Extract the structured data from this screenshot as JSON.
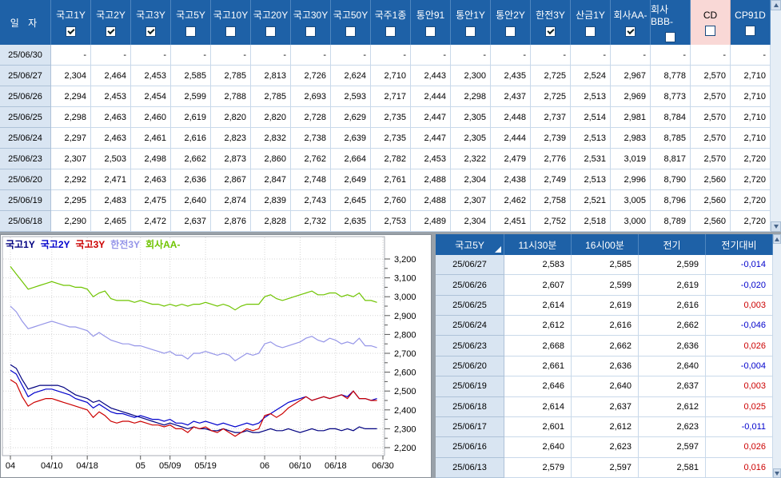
{
  "colors": {
    "header_blue": "#1e61a7",
    "header_separator": "#4f86bf",
    "date_cell_bg": "#d9e5f2",
    "grid_line": "#c9d9ea",
    "cd_header_bg": "#f9d8d6",
    "positive_red": "#cc0000",
    "negative_blue": "#0000cc",
    "window_gap": "#99a1a9"
  },
  "top_table": {
    "date_header": "일 자",
    "columns": [
      {
        "label": "국고1Y",
        "checked": true,
        "highlight": false
      },
      {
        "label": "국고2Y",
        "checked": true,
        "highlight": false
      },
      {
        "label": "국고3Y",
        "checked": true,
        "highlight": false
      },
      {
        "label": "국고5Y",
        "checked": false,
        "highlight": false
      },
      {
        "label": "국고10Y",
        "checked": false,
        "highlight": false
      },
      {
        "label": "국고20Y",
        "checked": false,
        "highlight": false
      },
      {
        "label": "국고30Y",
        "checked": false,
        "highlight": false
      },
      {
        "label": "국고50Y",
        "checked": false,
        "highlight": false
      },
      {
        "label": "국주1종",
        "checked": false,
        "highlight": false
      },
      {
        "label": "통안91",
        "checked": false,
        "highlight": false
      },
      {
        "label": "통안1Y",
        "checked": false,
        "highlight": false
      },
      {
        "label": "통안2Y",
        "checked": false,
        "highlight": false
      },
      {
        "label": "한전3Y",
        "checked": true,
        "highlight": false
      },
      {
        "label": "산금1Y",
        "checked": false,
        "highlight": false
      },
      {
        "label": "회사AA-",
        "checked": true,
        "highlight": false
      },
      {
        "label": "회사BBB-",
        "checked": false,
        "highlight": false
      },
      {
        "label": "CD",
        "checked": false,
        "highlight": true
      },
      {
        "label": "CP91D",
        "checked": false,
        "highlight": false
      }
    ],
    "rows": [
      {
        "date": "25/06/30",
        "values": [
          "-",
          "-",
          "-",
          "-",
          "-",
          "-",
          "-",
          "-",
          "-",
          "-",
          "-",
          "-",
          "-",
          "-",
          "-",
          "-",
          "-",
          "-"
        ]
      },
      {
        "date": "25/06/27",
        "values": [
          "2,304",
          "2,464",
          "2,453",
          "2,585",
          "2,785",
          "2,813",
          "2,726",
          "2,624",
          "2,710",
          "2,443",
          "2,300",
          "2,435",
          "2,725",
          "2,524",
          "2,967",
          "8,778",
          "2,570",
          "2,710"
        ]
      },
      {
        "date": "25/06/26",
        "values": [
          "2,294",
          "2,453",
          "2,454",
          "2,599",
          "2,788",
          "2,785",
          "2,693",
          "2,593",
          "2,717",
          "2,444",
          "2,298",
          "2,437",
          "2,725",
          "2,513",
          "2,969",
          "8,773",
          "2,570",
          "2,710"
        ]
      },
      {
        "date": "25/06/25",
        "values": [
          "2,298",
          "2,463",
          "2,460",
          "2,619",
          "2,820",
          "2,820",
          "2,728",
          "2,629",
          "2,735",
          "2,447",
          "2,305",
          "2,448",
          "2,737",
          "2,514",
          "2,981",
          "8,784",
          "2,570",
          "2,710"
        ]
      },
      {
        "date": "25/06/24",
        "values": [
          "2,297",
          "2,463",
          "2,461",
          "2,616",
          "2,823",
          "2,832",
          "2,738",
          "2,639",
          "2,735",
          "2,447",
          "2,305",
          "2,444",
          "2,739",
          "2,513",
          "2,983",
          "8,785",
          "2,570",
          "2,710"
        ]
      },
      {
        "date": "25/06/23",
        "values": [
          "2,307",
          "2,503",
          "2,498",
          "2,662",
          "2,873",
          "2,860",
          "2,762",
          "2,664",
          "2,782",
          "2,453",
          "2,322",
          "2,479",
          "2,776",
          "2,531",
          "3,019",
          "8,817",
          "2,570",
          "2,720"
        ]
      },
      {
        "date": "25/06/20",
        "values": [
          "2,292",
          "2,471",
          "2,463",
          "2,636",
          "2,867",
          "2,847",
          "2,748",
          "2,649",
          "2,761",
          "2,488",
          "2,304",
          "2,438",
          "2,749",
          "2,513",
          "2,996",
          "8,790",
          "2,560",
          "2,720"
        ]
      },
      {
        "date": "25/06/19",
        "values": [
          "2,295",
          "2,483",
          "2,475",
          "2,640",
          "2,874",
          "2,839",
          "2,743",
          "2,645",
          "2,760",
          "2,488",
          "2,307",
          "2,462",
          "2,758",
          "2,521",
          "3,005",
          "8,796",
          "2,560",
          "2,720"
        ]
      },
      {
        "date": "25/06/18",
        "values": [
          "2,290",
          "2,465",
          "2,472",
          "2,637",
          "2,876",
          "2,828",
          "2,732",
          "2,635",
          "2,753",
          "2,489",
          "2,304",
          "2,451",
          "2,752",
          "2,518",
          "3,000",
          "8,789",
          "2,560",
          "2,720"
        ]
      }
    ]
  },
  "chart_data": {
    "type": "line",
    "legend_position": "top-left",
    "grid": true,
    "ylim": [
      2.2,
      3.2
    ],
    "y_tick_labels": [
      "3,200",
      "3,100",
      "3,000",
      "2,900",
      "2,800",
      "2,700",
      "2,600",
      "2,500",
      "2,400",
      "2,300",
      "2,200"
    ],
    "x_tick_labels": [
      "04",
      "04/10",
      "04/18",
      "05",
      "05/09",
      "05/19",
      "06",
      "06/10",
      "06/18",
      "06/30"
    ],
    "x_tick_indices": [
      0,
      7,
      13,
      22,
      27,
      33,
      43,
      49,
      55,
      63
    ],
    "n_points": 64,
    "series": [
      {
        "name": "국고1Y",
        "color": "#000080",
        "values": [
          2.64,
          2.62,
          2.56,
          2.51,
          2.52,
          2.53,
          2.53,
          2.53,
          2.53,
          2.52,
          2.5,
          2.48,
          2.47,
          2.46,
          2.44,
          2.45,
          2.43,
          2.41,
          2.4,
          2.39,
          2.38,
          2.37,
          2.36,
          2.35,
          2.34,
          2.33,
          2.32,
          2.33,
          2.32,
          2.31,
          2.3,
          2.31,
          2.3,
          2.3,
          2.29,
          2.29,
          2.3,
          2.29,
          2.28,
          2.28,
          2.29,
          2.28,
          2.28,
          2.29,
          2.3,
          2.29,
          2.29,
          2.3,
          2.29,
          2.28,
          2.29,
          2.3,
          2.29,
          2.29,
          2.3,
          2.3,
          2.29,
          2.3,
          2.29,
          2.31,
          2.3,
          2.3,
          2.3
        ]
      },
      {
        "name": "국고2Y",
        "color": "#0000cc",
        "values": [
          2.61,
          2.59,
          2.53,
          2.47,
          2.49,
          2.5,
          2.51,
          2.51,
          2.5,
          2.49,
          2.48,
          2.46,
          2.45,
          2.44,
          2.41,
          2.43,
          2.41,
          2.39,
          2.38,
          2.38,
          2.37,
          2.36,
          2.37,
          2.36,
          2.35,
          2.35,
          2.34,
          2.35,
          2.33,
          2.33,
          2.32,
          2.34,
          2.33,
          2.34,
          2.33,
          2.32,
          2.33,
          2.32,
          2.31,
          2.32,
          2.33,
          2.32,
          2.33,
          2.36,
          2.38,
          2.4,
          2.42,
          2.44,
          2.45,
          2.46,
          2.47,
          2.45,
          2.46,
          2.47,
          2.46,
          2.47,
          2.48,
          2.47,
          2.5,
          2.46,
          2.46,
          2.45,
          2.46
        ]
      },
      {
        "name": "국고3Y",
        "color": "#cc0000",
        "values": [
          2.56,
          2.54,
          2.47,
          2.42,
          2.44,
          2.45,
          2.46,
          2.46,
          2.45,
          2.44,
          2.43,
          2.42,
          2.41,
          2.4,
          2.36,
          2.39,
          2.37,
          2.34,
          2.33,
          2.34,
          2.34,
          2.33,
          2.34,
          2.33,
          2.32,
          2.32,
          2.31,
          2.32,
          2.3,
          2.3,
          2.28,
          2.31,
          2.3,
          2.31,
          2.29,
          2.28,
          2.3,
          2.28,
          2.26,
          2.28,
          2.3,
          2.29,
          2.3,
          2.37,
          2.38,
          2.36,
          2.38,
          2.41,
          2.43,
          2.45,
          2.47,
          2.45,
          2.46,
          2.47,
          2.46,
          2.47,
          2.48,
          2.46,
          2.5,
          2.46,
          2.46,
          2.45,
          2.45
        ]
      },
      {
        "name": "한전3Y",
        "color": "#9595e8",
        "values": [
          2.95,
          2.92,
          2.87,
          2.83,
          2.84,
          2.85,
          2.86,
          2.87,
          2.86,
          2.85,
          2.84,
          2.84,
          2.83,
          2.82,
          2.79,
          2.81,
          2.79,
          2.77,
          2.76,
          2.75,
          2.75,
          2.74,
          2.74,
          2.73,
          2.72,
          2.71,
          2.7,
          2.71,
          2.69,
          2.69,
          2.67,
          2.7,
          2.7,
          2.71,
          2.7,
          2.69,
          2.7,
          2.69,
          2.66,
          2.68,
          2.7,
          2.69,
          2.7,
          2.75,
          2.76,
          2.74,
          2.73,
          2.74,
          2.75,
          2.76,
          2.78,
          2.79,
          2.77,
          2.76,
          2.78,
          2.77,
          2.75,
          2.76,
          2.75,
          2.78,
          2.74,
          2.74,
          2.73
        ]
      },
      {
        "name": "회사AA-",
        "color": "#6fc400",
        "values": [
          3.16,
          3.12,
          3.08,
          3.04,
          3.05,
          3.06,
          3.07,
          3.08,
          3.07,
          3.06,
          3.06,
          3.05,
          3.05,
          3.04,
          3.0,
          3.02,
          3.03,
          2.99,
          2.98,
          2.98,
          2.98,
          2.97,
          2.98,
          2.97,
          2.96,
          2.96,
          2.95,
          2.96,
          2.95,
          2.96,
          2.95,
          2.96,
          2.96,
          2.97,
          2.96,
          2.95,
          2.96,
          2.95,
          2.93,
          2.95,
          2.96,
          2.96,
          2.96,
          3.0,
          3.01,
          2.99,
          2.98,
          2.99,
          3.0,
          3.01,
          3.02,
          3.03,
          3.01,
          3.01,
          3.02,
          3.02,
          3.0,
          3.01,
          3.0,
          3.02,
          2.98,
          2.98,
          2.97
        ]
      }
    ]
  },
  "right_table": {
    "headers": [
      "국고5Y",
      "11시30분",
      "16시00분",
      "전기",
      "전기대비"
    ],
    "rows": [
      {
        "date": "25/06/27",
        "values": [
          "2,583",
          "2,585",
          "2,599"
        ],
        "change": "-0,014"
      },
      {
        "date": "25/06/26",
        "values": [
          "2,607",
          "2,599",
          "2,619"
        ],
        "change": "-0,020"
      },
      {
        "date": "25/06/25",
        "values": [
          "2,614",
          "2,619",
          "2,616"
        ],
        "change": "0,003"
      },
      {
        "date": "25/06/24",
        "values": [
          "2,612",
          "2,616",
          "2,662"
        ],
        "change": "-0,046"
      },
      {
        "date": "25/06/23",
        "values": [
          "2,668",
          "2,662",
          "2,636"
        ],
        "change": "0,026"
      },
      {
        "date": "25/06/20",
        "values": [
          "2,661",
          "2,636",
          "2,640"
        ],
        "change": "-0,004"
      },
      {
        "date": "25/06/19",
        "values": [
          "2,646",
          "2,640",
          "2,637"
        ],
        "change": "0,003"
      },
      {
        "date": "25/06/18",
        "values": [
          "2,614",
          "2,637",
          "2,612"
        ],
        "change": "0,025"
      },
      {
        "date": "25/06/17",
        "values": [
          "2,601",
          "2,612",
          "2,623"
        ],
        "change": "-0,011"
      },
      {
        "date": "25/06/16",
        "values": [
          "2,640",
          "2,623",
          "2,597"
        ],
        "change": "0,026"
      },
      {
        "date": "25/06/13",
        "values": [
          "2,579",
          "2,597",
          "2,581"
        ],
        "change": "0,016"
      }
    ]
  }
}
